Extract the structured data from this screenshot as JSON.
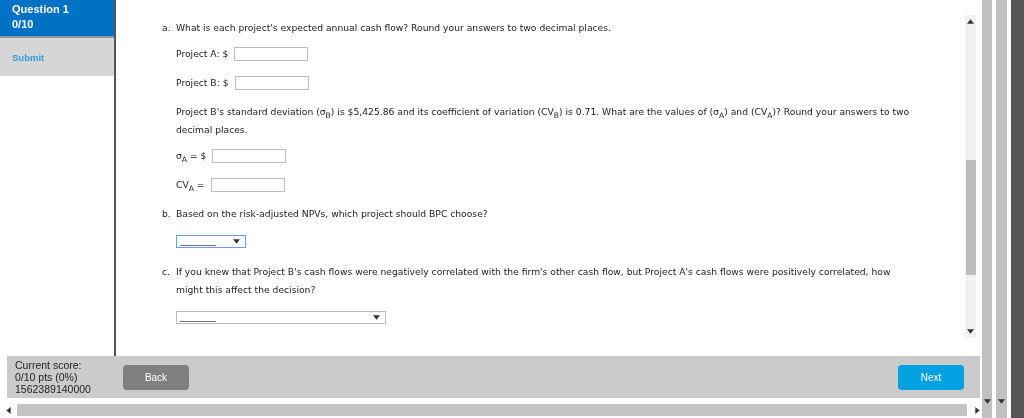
{
  "sidebar": {
    "question": "Question 1",
    "score": "0/10",
    "submit": "Submit"
  },
  "content": [
    {
      "kind": "prompt",
      "marker": "a.",
      "text": "What is each project's expected annual cash flow? Round your answers to two decimal places."
    },
    {
      "kind": "field",
      "label": "Project A: $"
    },
    {
      "kind": "field",
      "label": "Project B: $"
    },
    {
      "kind": "text",
      "text": "Project B's standard deviation (σ$_{B}$) is $5,425.86 and its coefficient of variation (CV$_{B}$) is 0.71. What are the values of (σ$_{A}$) and (CV$_{A}$)? Round your answers to two decimal places."
    },
    {
      "kind": "field",
      "label": "σ$_{A}$ = $"
    },
    {
      "kind": "field",
      "label": "CV$_{A}$ ="
    },
    {
      "kind": "prompt",
      "marker": "b.",
      "text": "Based on the risk-adjusted NPVs, which project should BPC choose?"
    },
    {
      "kind": "select",
      "value": "________",
      "focused": true
    },
    {
      "kind": "prompt",
      "marker": "c.",
      "text": "If you knew that Project B's cash flows were negatively correlated with the firm's other cash flow, but Project A's cash flows were positively correlated, how might this affect the decision?"
    },
    {
      "kind": "wide-select",
      "value": "________",
      "focused": false
    }
  ],
  "footer": {
    "score_lines": [
      "Current score:",
      "0/10 pts (0%)",
      "1562389140000"
    ],
    "back": "Back",
    "next": "Next"
  }
}
